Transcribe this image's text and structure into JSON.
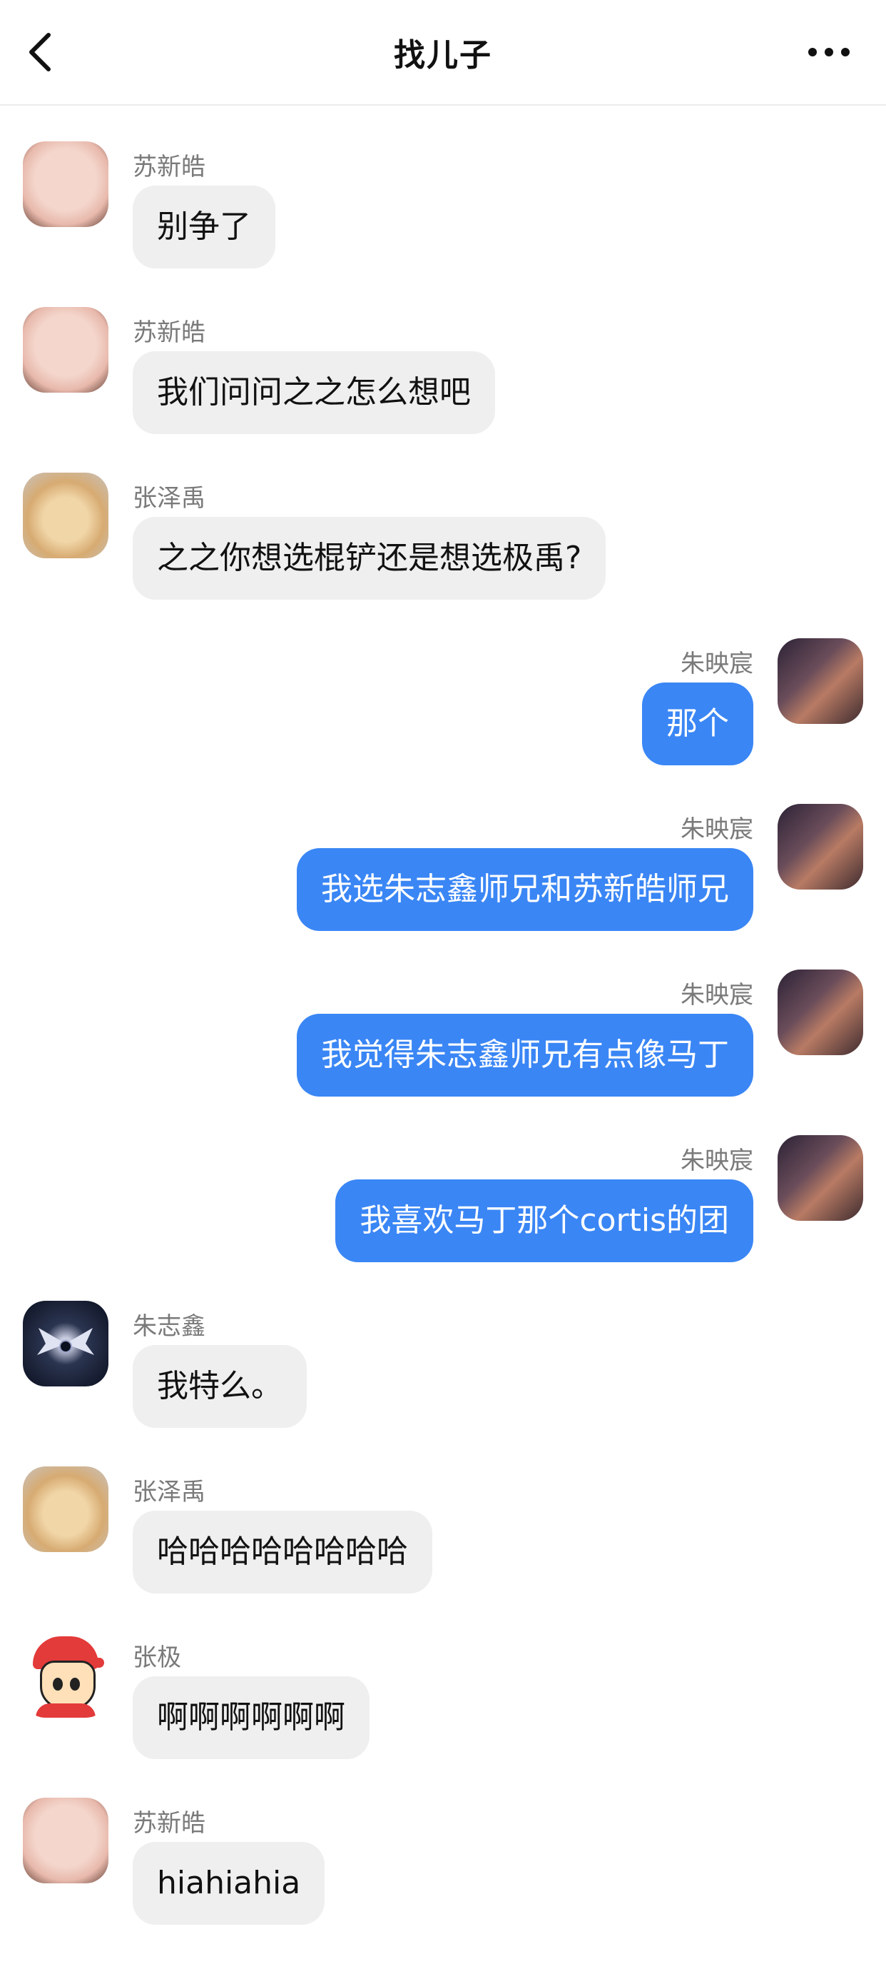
{
  "header": {
    "title": "找儿子",
    "back_icon": "chevron-left-icon",
    "more_icon": "ellipsis-icon"
  },
  "messages": [
    {
      "side": "left",
      "sender": "苏新皓",
      "text": "别争了",
      "avatar": "avatar-suxinhao"
    },
    {
      "side": "left",
      "sender": "苏新皓",
      "text": "我们问问之之怎么想吧",
      "avatar": "avatar-suxinhao"
    },
    {
      "side": "left",
      "sender": "张泽禹",
      "text": "之之你想选棍铲还是想选极禹?",
      "avatar": "avatar-zhangzeyu"
    },
    {
      "side": "right",
      "sender": "朱映宸",
      "text": "那个",
      "avatar": "avatar-zhuyingchen"
    },
    {
      "side": "right",
      "sender": "朱映宸",
      "text": "我选朱志鑫师兄和苏新皓师兄",
      "avatar": "avatar-zhuyingchen"
    },
    {
      "side": "right",
      "sender": "朱映宸",
      "text": "我觉得朱志鑫师兄有点像马丁",
      "avatar": "avatar-zhuyingchen"
    },
    {
      "side": "right",
      "sender": "朱映宸",
      "text": "我喜欢马丁那个cortis的团",
      "avatar": "avatar-zhuyingchen"
    },
    {
      "side": "left",
      "sender": "朱志鑫",
      "text": "我特么。",
      "avatar": "avatar-zhuzhixin"
    },
    {
      "side": "left",
      "sender": "张泽禹",
      "text": "哈哈哈哈哈哈哈哈",
      "avatar": "avatar-zhangzeyu"
    },
    {
      "side": "left",
      "sender": "张极",
      "text": "啊啊啊啊啊啊",
      "avatar": "avatar-zhangji"
    },
    {
      "side": "left",
      "sender": "苏新皓",
      "text": "hiahiahia",
      "avatar": "avatar-suxinhao"
    }
  ],
  "colors": {
    "outgoing_bubble": "#3a86f5",
    "incoming_bubble": "#efefef",
    "sender_name": "#7a7a7a"
  }
}
